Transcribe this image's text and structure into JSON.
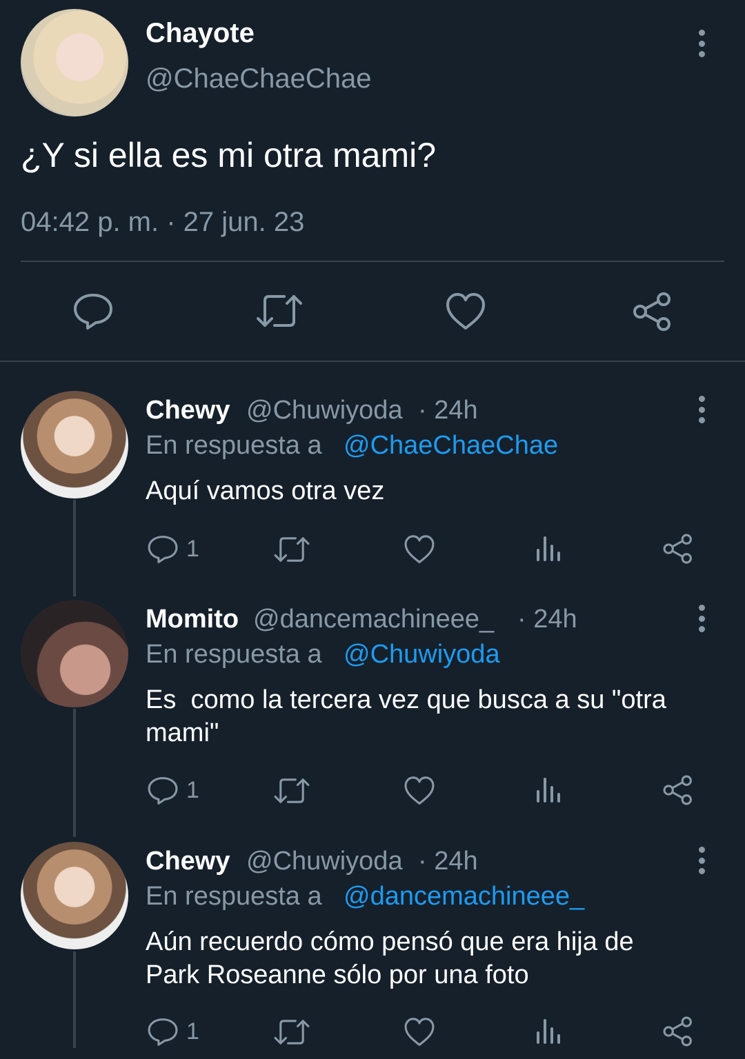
{
  "main_tweet": {
    "display_name": "Chayote",
    "handle": "@ChaeChaeChae",
    "text": "¿Y si ella es mi otra mami?",
    "timestamp": "04:42 p. m. · 27 jun. 23",
    "actions": [
      "reply-icon",
      "retweet-icon",
      "like-icon",
      "share-icon"
    ]
  },
  "replies": [
    {
      "display_name": "Chewy",
      "handle": "@Chuwiyoda",
      "time": "· 24h",
      "reply_to_prefix": "En respuesta a",
      "reply_to": "@ChaeChaeChae",
      "text": "Aquí vamos otra vez",
      "reply_count": "1"
    },
    {
      "display_name": "Momito",
      "handle": "@dancemachineee_",
      "time": "· 24h",
      "reply_to_prefix": "En respuesta a",
      "reply_to": "@Chuwiyoda",
      "text_line1": "Es  como la tercera vez que busca a su \"otra",
      "text_line2": "mami\"",
      "reply_count": "1"
    },
    {
      "display_name": "Chewy",
      "handle": "@Chuwiyoda",
      "time": "· 24h",
      "reply_to_prefix": "En respuesta a",
      "reply_to": "@dancemachineee_",
      "text_line1": "Aún recuerdo cómo pensó que era hija de",
      "text_line2": "Park Roseanne sólo por una foto",
      "reply_count": "1"
    }
  ],
  "colors": {
    "background": "#15202b",
    "muted": "#8899a6",
    "link": "#1d9bf0",
    "divider": "#38444d"
  }
}
